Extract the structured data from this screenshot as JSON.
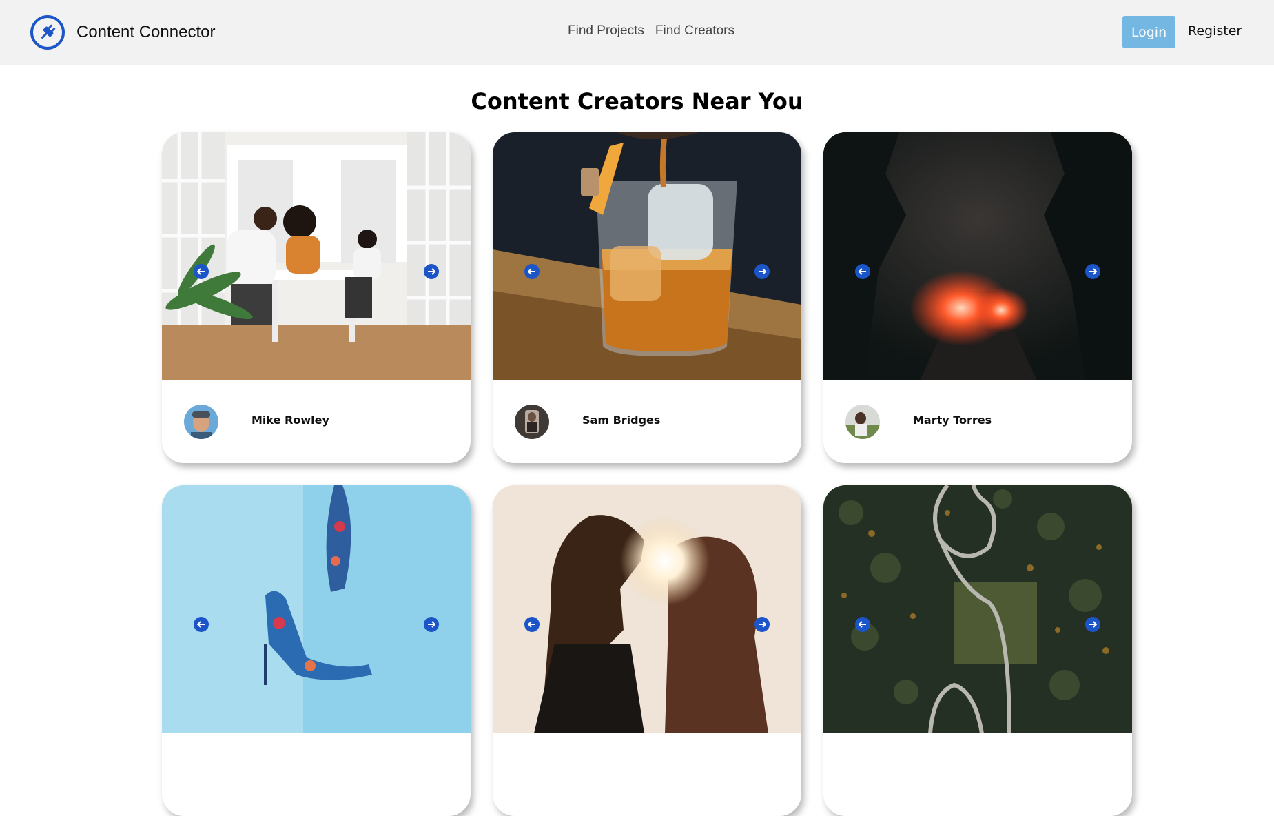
{
  "header": {
    "brand_name": "Content Connector",
    "brand_icon": "plug-icon",
    "nav_links": [
      "Find Projects",
      "Find Creators"
    ],
    "login_label": "Login",
    "register_label": "Register"
  },
  "page_title": "Content Creators Near You",
  "creators": [
    {
      "name": "Mike Rowley"
    },
    {
      "name": "Sam Bridges"
    },
    {
      "name": "Marty Torres"
    },
    {
      "name": ""
    },
    {
      "name": ""
    },
    {
      "name": ""
    }
  ],
  "colors": {
    "accent": "#1b55c8",
    "login_button": "#74b7e3",
    "navbar_bg": "#f2f2f2"
  }
}
